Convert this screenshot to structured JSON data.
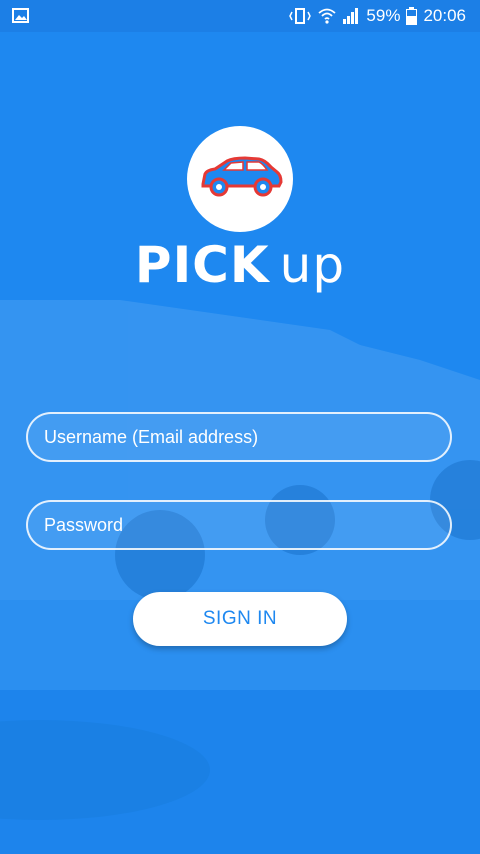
{
  "status_bar": {
    "battery": "59%",
    "time": "20:06",
    "icons": [
      "image-icon",
      "vibrate-icon",
      "wifi-icon",
      "signal-icon",
      "battery-icon"
    ]
  },
  "brand": {
    "bold": "PICK",
    "light": "up",
    "logo_icon": "car-icon"
  },
  "form": {
    "username_placeholder": "Username (Email address)",
    "password_placeholder": "Password",
    "signin_label": "SIGN IN"
  },
  "colors": {
    "background": "#1e88f0",
    "accent_white": "#ffffff",
    "car_red": "#e53935"
  }
}
